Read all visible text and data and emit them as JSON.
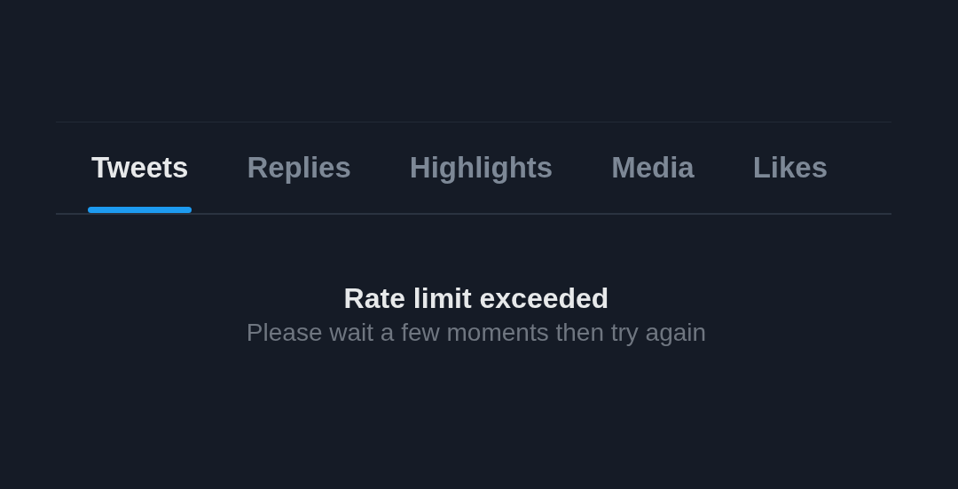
{
  "tabs": [
    {
      "label": "Tweets",
      "selected": true
    },
    {
      "label": "Replies",
      "selected": false
    },
    {
      "label": "Highlights",
      "selected": false
    },
    {
      "label": "Media",
      "selected": false
    },
    {
      "label": "Likes",
      "selected": false
    }
  ],
  "message": {
    "title": "Rate limit exceeded",
    "body": "Please wait a few moments then try again"
  }
}
